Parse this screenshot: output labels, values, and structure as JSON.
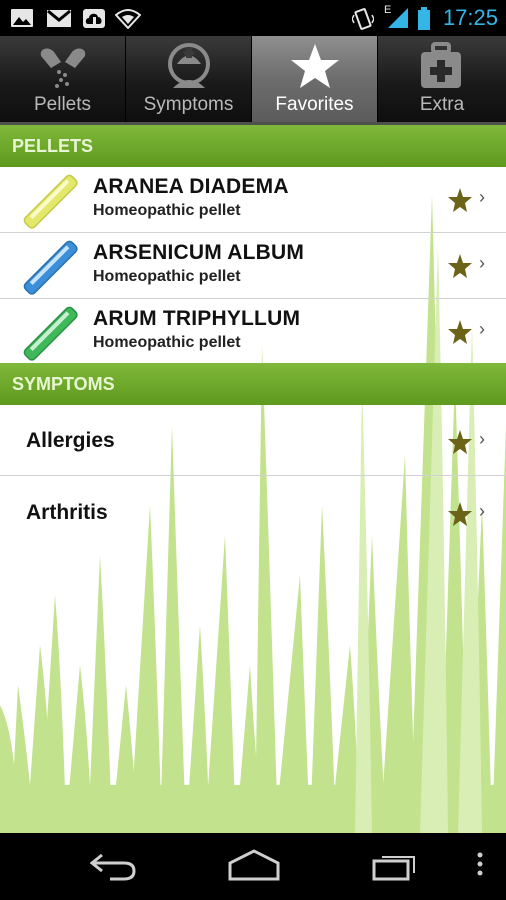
{
  "status_bar": {
    "time": "17:25",
    "network_label": "E",
    "left_icons": [
      "gallery-icon",
      "gmail-icon",
      "upload-icon",
      "wifi-icon"
    ],
    "right_icons": [
      "vibrate-icon",
      "signal-icon",
      "battery-icon"
    ]
  },
  "tabs": [
    {
      "label": "Pellets",
      "icon": "pellets-icon",
      "active": false
    },
    {
      "label": "Symptoms",
      "icon": "symptoms-icon",
      "active": false
    },
    {
      "label": "Favorites",
      "icon": "star-icon",
      "active": true
    },
    {
      "label": "Extra",
      "icon": "first-aid-icon",
      "active": false
    }
  ],
  "pellets_section": {
    "header": "PELLETS",
    "items": [
      {
        "name": "ARANEA DIADEMA",
        "subtitle": "Homeopathic pellet",
        "tube_color": "#e4e86a",
        "favorite": true
      },
      {
        "name": "ARSENICUM ALBUM",
        "subtitle": "Homeopathic pellet",
        "tube_color": "#3a8fd8",
        "favorite": true
      },
      {
        "name": "ARUM TRIPHYLLUM",
        "subtitle": "Homeopathic pellet",
        "tube_color": "#3fb85a",
        "favorite": true
      }
    ]
  },
  "symptoms_section": {
    "header": "SYMPTOMS",
    "items": [
      {
        "name": "Allergies",
        "favorite": true
      },
      {
        "name": "Arthritis",
        "favorite": true
      }
    ]
  },
  "colors": {
    "accent_green": "#6aa82a",
    "star_olive": "#6b6418",
    "status_blue": "#33b5e5",
    "grass_green": "#bfe08a"
  },
  "nav_bar": {
    "buttons": [
      "back-icon",
      "home-icon",
      "recent-apps-icon",
      "menu-icon"
    ]
  }
}
